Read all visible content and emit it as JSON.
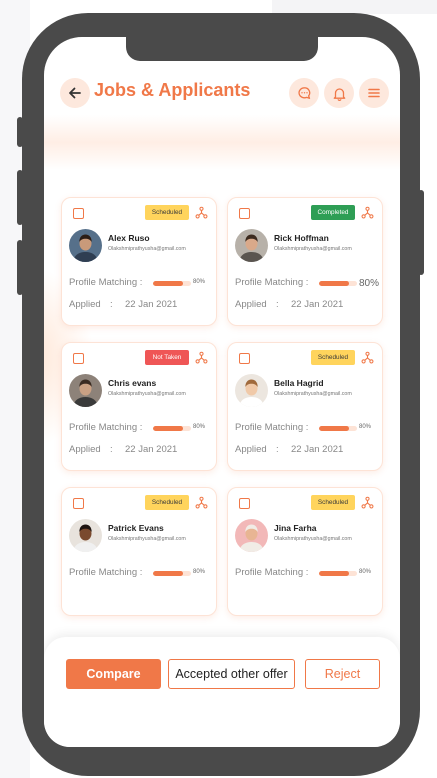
{
  "header": {
    "title": "Jobs & Applicants",
    "back_icon": "arrow-left-icon",
    "chat_icon": "chat-icon",
    "bell_icon": "bell-icon",
    "menu_icon": "hamburger-menu-icon"
  },
  "colors": {
    "accent": "#f07848",
    "scheduled": "#ffd45c",
    "completed": "#2e9e55",
    "not_taken": "#ef5656"
  },
  "applicants": [
    {
      "name": "Alex Ruso",
      "email": "Olakshmiprathyusha@gmail.com",
      "status": "Scheduled",
      "status_type": "scheduled",
      "match_label": "Profile Matching :",
      "match_value": 0.8,
      "match_text": "80%",
      "applied_label": "Applied",
      "applied_colon": ":",
      "applied_date": "22 Jan 2021"
    },
    {
      "name": "Rick Hoffman",
      "email": "Olakshmiprathyusha@gmail.com",
      "status": "Completed",
      "status_type": "completed",
      "match_label": "Profile Matching :",
      "match_value": 0.8,
      "match_text": "80%",
      "applied_label": "Applied",
      "applied_colon": ":",
      "applied_date": "22 Jan 2021"
    },
    {
      "name": "Chris evans",
      "email": "Olakshmiprathyusha@gmail.com",
      "status": "Not Taken",
      "status_type": "nottaken",
      "match_label": "Profile Matching :",
      "match_value": 0.8,
      "match_text": "80%",
      "applied_label": "Applied",
      "applied_colon": ":",
      "applied_date": "22 Jan 2021"
    },
    {
      "name": "Bella Hagrid",
      "email": "Olakshmiprathyusha@gmail.com",
      "status": "Scheduled",
      "status_type": "scheduled",
      "match_label": "Profile Matching :",
      "match_value": 0.8,
      "match_text": "80%",
      "applied_label": "Applied",
      "applied_colon": ":",
      "applied_date": "22 Jan 2021"
    },
    {
      "name": "Patrick Evans",
      "email": "Olakshmiprathyusha@gmail.com",
      "status": "Scheduled",
      "status_type": "scheduled",
      "match_label": "Profile Matching :",
      "match_value": 0.8,
      "match_text": "80%"
    },
    {
      "name": "Jina Farha",
      "email": "Olakshmiprathyusha@gmail.com",
      "status": "Scheduled",
      "status_type": "scheduled",
      "match_label": "Profile Matching :",
      "match_value": 0.8,
      "match_text": "80%"
    }
  ],
  "footer": {
    "compare_label": "Compare",
    "accepted_label": "Accepted other offer",
    "reject_label": "Reject"
  }
}
